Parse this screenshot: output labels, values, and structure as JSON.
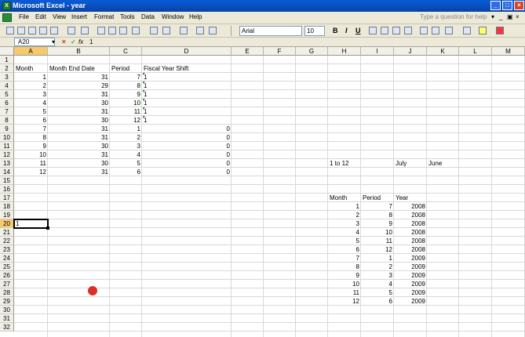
{
  "window": {
    "title": "Microsoft Excel - year",
    "app_icon": "X"
  },
  "menu": [
    "File",
    "Edit",
    "View",
    "Insert",
    "Format",
    "Tools",
    "Data",
    "Window",
    "Help"
  ],
  "help_placeholder": "Type a question for help",
  "toolbar": {
    "font": "Arial",
    "size": "10",
    "bold": "B",
    "italic": "I",
    "underline": "U"
  },
  "formula_bar": {
    "name_box": "A20",
    "value": "1",
    "fx": "fx"
  },
  "columns": [
    "A",
    "B",
    "C",
    "D",
    "E",
    "F",
    "G",
    "H",
    "I",
    "J",
    "K",
    "L",
    "M"
  ],
  "rows": [
    "1",
    "2",
    "3",
    "4",
    "5",
    "6",
    "7",
    "8",
    "9",
    "10",
    "11",
    "12",
    "13",
    "14",
    "15",
    "16",
    "17",
    "18",
    "19",
    "20",
    "21",
    "22",
    "23",
    "24",
    "25",
    "26",
    "27",
    "28",
    "29",
    "30",
    "31",
    "32"
  ],
  "active": {
    "col": "A",
    "row": "20",
    "value": "1"
  },
  "table1": {
    "headers": [
      "Month",
      "Month End Date",
      "Period",
      "Fiscal Year Shift"
    ],
    "rows": [
      {
        "month": "1",
        "end": "31",
        "period": "7",
        "shift": "1"
      },
      {
        "month": "2",
        "end": "29",
        "period": "8",
        "shift": "1"
      },
      {
        "month": "3",
        "end": "31",
        "period": "9",
        "shift": "1"
      },
      {
        "month": "4",
        "end": "30",
        "period": "10",
        "shift": "1"
      },
      {
        "month": "5",
        "end": "31",
        "period": "11",
        "shift": "1"
      },
      {
        "month": "6",
        "end": "30",
        "period": "12",
        "shift": "1"
      },
      {
        "month": "7",
        "end": "31",
        "period": "1",
        "shift": "0"
      },
      {
        "month": "8",
        "end": "31",
        "period": "2",
        "shift": "0"
      },
      {
        "month": "9",
        "end": "30",
        "period": "3",
        "shift": "0"
      },
      {
        "month": "10",
        "end": "31",
        "period": "4",
        "shift": "0"
      },
      {
        "month": "11",
        "end": "30",
        "period": "5",
        "shift": "0"
      },
      {
        "month": "12",
        "end": "31",
        "period": "6",
        "shift": "0"
      }
    ]
  },
  "side_labels": {
    "range": "1 to 12",
    "start": "July",
    "end": "June"
  },
  "table2": {
    "headers": [
      "Month",
      "Period",
      "Year"
    ],
    "rows": [
      {
        "month": "1",
        "period": "7",
        "year": "2008"
      },
      {
        "month": "2",
        "period": "8",
        "year": "2008"
      },
      {
        "month": "3",
        "period": "9",
        "year": "2008"
      },
      {
        "month": "4",
        "period": "10",
        "year": "2008"
      },
      {
        "month": "5",
        "period": "11",
        "year": "2008"
      },
      {
        "month": "6",
        "period": "12",
        "year": "2008"
      },
      {
        "month": "7",
        "period": "1",
        "year": "2009"
      },
      {
        "month": "8",
        "period": "2",
        "year": "2009"
      },
      {
        "month": "9",
        "period": "3",
        "year": "2009"
      },
      {
        "month": "10",
        "period": "4",
        "year": "2009"
      },
      {
        "month": "11",
        "period": "5",
        "year": "2009"
      },
      {
        "month": "12",
        "period": "6",
        "year": "2009"
      }
    ]
  }
}
